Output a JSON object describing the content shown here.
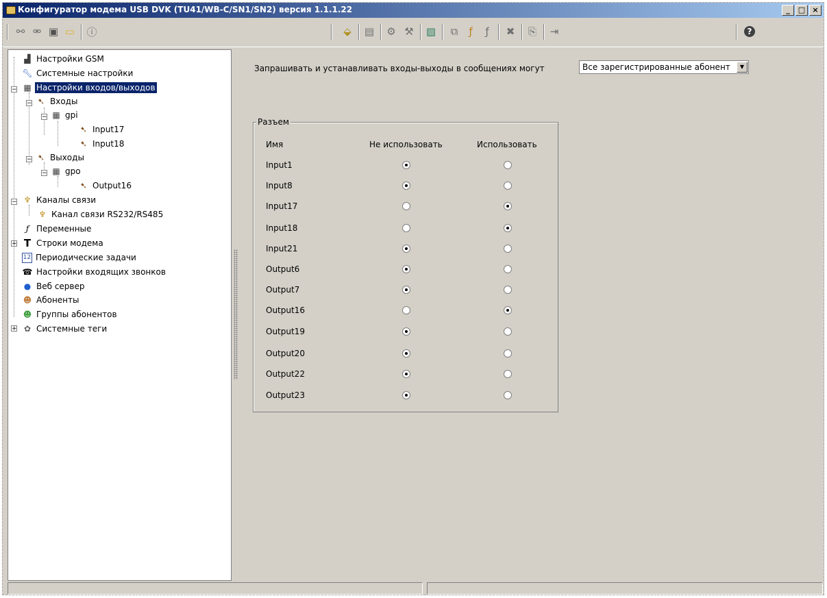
{
  "window": {
    "title": "Конфигуратор модема USB DVK (TU41/WB-C/SN1/SN2)  версия 1.1.1.22",
    "buttons": [
      "_",
      "□",
      "×"
    ]
  },
  "toolbar": {
    "icons": [
      "connect-icon",
      "disconnect-icon",
      "save-icon",
      "open-folder-icon",
      "info-icon",
      "read-device-icon",
      "write-device-icon",
      "settings-icon",
      "tools-icon",
      "image-icon",
      "copy-icon",
      "add-variable-icon",
      "variable-icon",
      "delete-icon",
      "export-icon",
      "import-icon"
    ],
    "help_label": "?"
  },
  "tree": {
    "items": [
      {
        "label": "Настройки GSM",
        "icon": "signal-icon"
      },
      {
        "label": "Системные настройки",
        "icon": "wrench-icon"
      },
      {
        "label": "Настройки входов/выходов",
        "icon": "chip-icon",
        "selected": true
      },
      {
        "label": "Входы",
        "icon": "connector-icon"
      },
      {
        "label": "gpi",
        "icon": "chip-icon"
      },
      {
        "label": "Input17",
        "icon": "connector-icon"
      },
      {
        "label": "Input18",
        "icon": "connector-icon"
      },
      {
        "label": "Выходы",
        "icon": "connector-icon"
      },
      {
        "label": "gpo",
        "icon": "chip-icon"
      },
      {
        "label": "Output16",
        "icon": "connector-icon"
      },
      {
        "label": "Каналы связи",
        "icon": "antenna-icon"
      },
      {
        "label": "Канал связи RS232/RS485",
        "icon": "antenna-icon"
      },
      {
        "label": "Переменные",
        "icon": "function-icon"
      },
      {
        "label": "Строки модема",
        "icon": "text-icon"
      },
      {
        "label": "Периодические задачи",
        "icon": "calendar-icon"
      },
      {
        "label": "Настройки входящих звонков",
        "icon": "phone-icon"
      },
      {
        "label": "Веб сервер",
        "icon": "globe-icon"
      },
      {
        "label": "Абоненты",
        "icon": "user-icon"
      },
      {
        "label": "Группы абонентов",
        "icon": "users-icon"
      },
      {
        "label": "Системные теги",
        "icon": "tags-icon"
      }
    ]
  },
  "main": {
    "prompt": "Запрашивать и устанавливать входы-выходы в сообщениях могут",
    "select_value": "Все зарегистрированные абонент",
    "group_title": "Разъем",
    "headers": {
      "name": "Имя",
      "unused": "Не использовать",
      "used": "Использовать"
    },
    "rows": [
      {
        "name": "Input1",
        "used": false
      },
      {
        "name": "Input8",
        "used": false
      },
      {
        "name": "Input17",
        "used": true
      },
      {
        "name": "Input18",
        "used": true
      },
      {
        "name": "Input21",
        "used": false
      },
      {
        "name": "Output6",
        "used": false
      },
      {
        "name": "Output7",
        "used": false
      },
      {
        "name": "Output16",
        "used": true
      },
      {
        "name": "Output19",
        "used": false
      },
      {
        "name": "Output20",
        "used": false
      },
      {
        "name": "Output22",
        "used": false
      },
      {
        "name": "Output23",
        "used": false
      }
    ]
  }
}
